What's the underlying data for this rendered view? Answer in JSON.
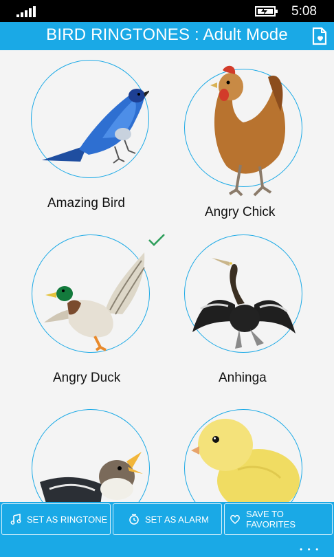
{
  "status": {
    "time": "5:08",
    "signal_icon": "signal-strength-icon",
    "battery_icon": "battery-charging-icon"
  },
  "header": {
    "title": "BIRD RINGTONES : Adult Mode",
    "action_icon": "favorites-file-icon"
  },
  "birds": [
    {
      "name": "Amazing Bird",
      "selected": false
    },
    {
      "name": "Angry Chick",
      "selected": false
    },
    {
      "name": "Angry Duck",
      "selected": true
    },
    {
      "name": "Anhinga",
      "selected": false
    },
    {
      "name": "",
      "selected": false
    },
    {
      "name": "",
      "selected": false
    }
  ],
  "actions": {
    "ringtone_label": "SET AS RINGTONE",
    "alarm_label": "SET AS ALARM",
    "favorites_label": "SAVE TO FAVORITES",
    "more_label": "• • •"
  },
  "colors": {
    "accent": "#1aa9e6",
    "check": "#2e9e5b"
  }
}
